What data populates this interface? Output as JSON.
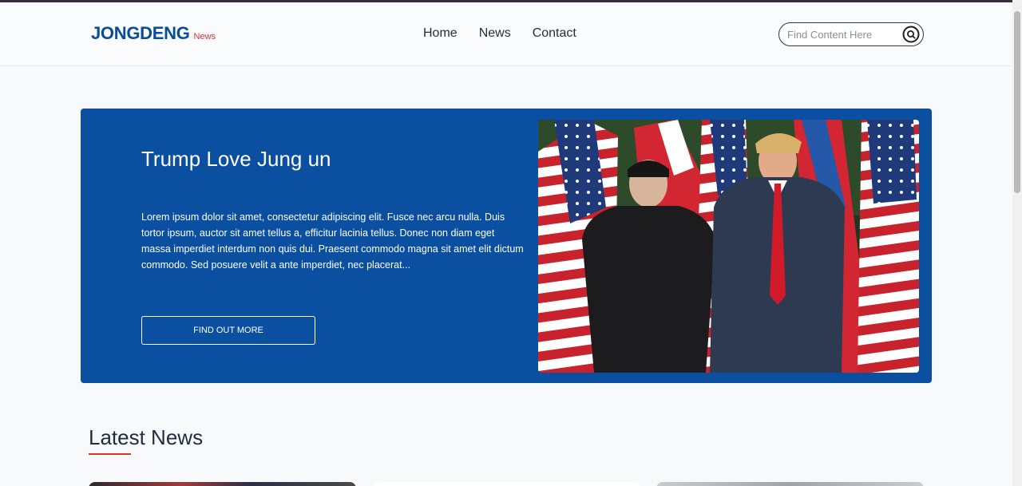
{
  "brand": {
    "name": "JONGDENG",
    "tag": "News"
  },
  "nav": {
    "links": [
      "Home",
      "News",
      "Contact"
    ]
  },
  "search": {
    "placeholder": "Find Content Here"
  },
  "hero": {
    "title": "Trump Love Jung un",
    "description": "Lorem ipsum dolor sit amet, consectetur adipiscing elit. Fusce nec arcu nulla. Duis tortor ipsum, auctor sit amet tellus a, efficitur lacinia tellus. Donec non diam eget massa imperdiet interdum non quis dui. Praesent commodo magna sit amet elit dictum commodo. Sed posuere velit a ante imperdiet, nec placerat...",
    "cta_label": "FIND OUT MORE"
  },
  "latest": {
    "title": "Latest News"
  },
  "colors": {
    "brand": "#0a4d97",
    "accent": "#e2312b",
    "hero_bg": "#0a4fa0"
  },
  "icons": {
    "search": "search-icon"
  }
}
